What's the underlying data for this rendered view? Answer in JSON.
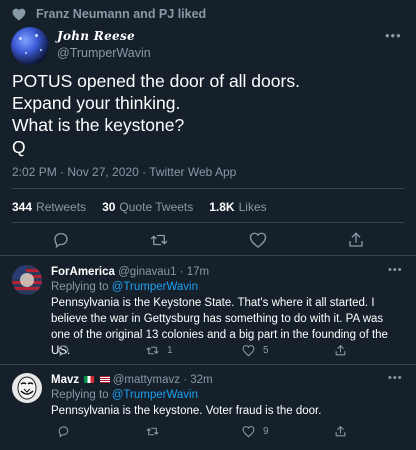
{
  "social_context": "Franz Neumann and PJ liked",
  "main_tweet": {
    "author_name": "John Reese",
    "handle": "@TrumperWavin",
    "text_lines": [
      "POTUS opened the door of all doors.",
      "Expand your thinking.",
      "What is the keystone?",
      "Q"
    ],
    "timestamp": "2:02 PM · Nov 27, 2020 · Twitter Web App",
    "stats": {
      "retweets_count": "344",
      "retweets_label": "Retweets",
      "quotes_count": "30",
      "quotes_label": "Quote Tweets",
      "likes_count": "1.8K",
      "likes_label": "Likes"
    }
  },
  "replies": [
    {
      "name": "ForAmerica",
      "handle_time": "@ginavau1 · 17m",
      "replying_label": "Replying to",
      "replying_handle": "@TrumperWavin",
      "body": "Pennsylvania is the Keystone State. That's where it all started. I believe the war in Gettysburg has something to do with it. PA was one of the original 13 colonies and a big part in the founding of the US.",
      "retweets": "1",
      "likes": "5"
    },
    {
      "name": "Mavz",
      "handle_time": "@mattymavz · 32m",
      "replying_label": "Replying to",
      "replying_handle": "@TrumperWavin",
      "body": "Pennsylvania is the keystone. Voter fraud is the door.",
      "retweets": "",
      "likes": "9"
    }
  ],
  "icons": {
    "heart": "heart-icon",
    "reply": "reply-icon",
    "retweet": "retweet-icon",
    "like": "like-icon",
    "share": "share-icon",
    "more": "more-icon"
  },
  "more_glyph": "•••",
  "colors": {
    "background": "#15202b",
    "muted": "#8899a6",
    "link": "#1da1f2",
    "divider": "#38444d"
  }
}
